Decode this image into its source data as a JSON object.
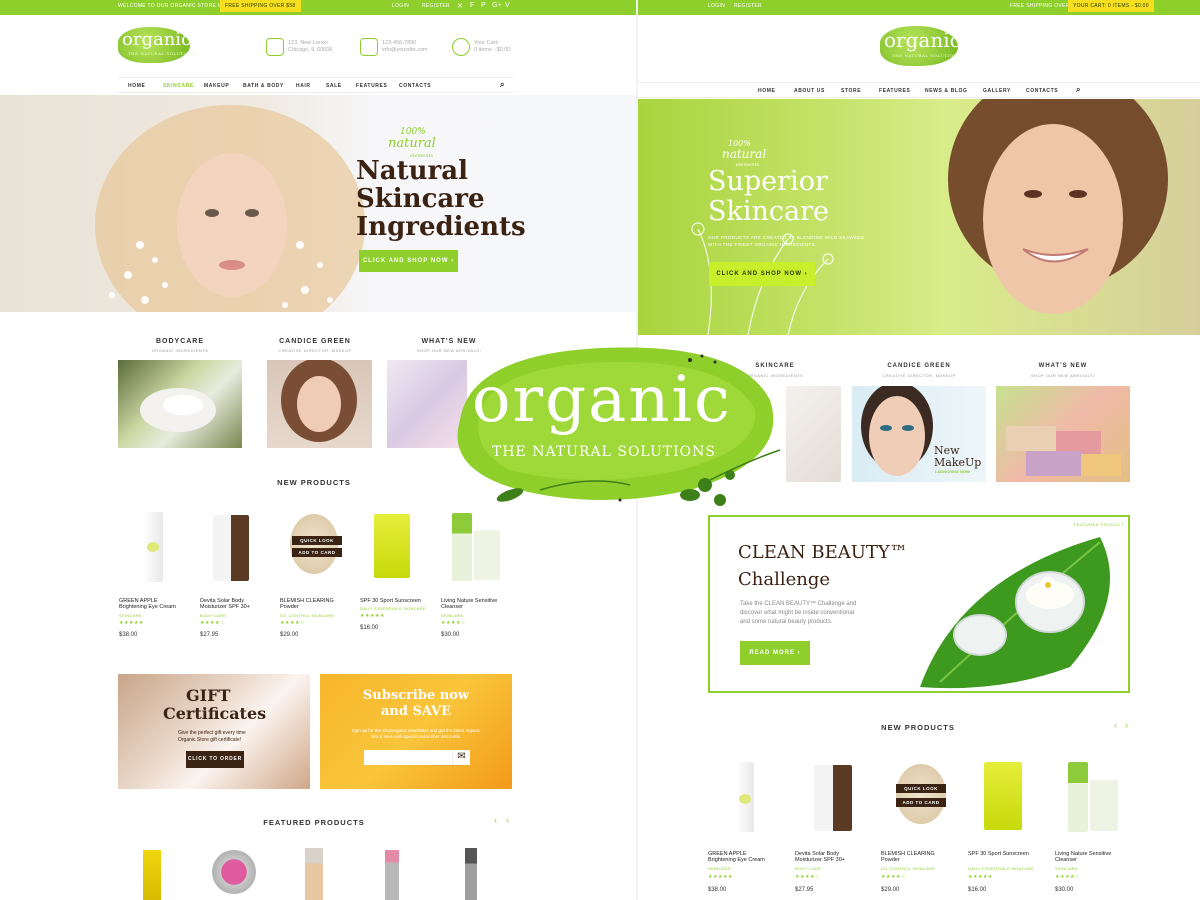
{
  "left": {
    "topbar": {
      "welcome": "WELCOME TO OUR ORGANIC STORE WEBSITE!",
      "shipping": "FREE SHIPPING OVER $58",
      "login": "LOGIN",
      "register": "REGISTER",
      "social_icons": [
        "twitter-icon",
        "facebook-icon",
        "pinterest-icon",
        "google-plus-icon",
        "vimeo-icon"
      ]
    },
    "logo": {
      "name": "organic",
      "tagline": "THE NATURAL SOLUTIONS"
    },
    "contacts": {
      "address_line1": "123, New Lenox",
      "address_line2": "Chicago, IL 60606",
      "phone": "123-456-7890",
      "email": "info@yoursite.com",
      "cart_label": "Your Cart:",
      "cart_value": "0 items - $0.00"
    },
    "nav": [
      "HOME",
      "SKINCARE",
      "MAKEUP",
      "BATH & BODY",
      "HAIR",
      "SALE",
      "FEATURES",
      "CONTACTS"
    ],
    "hero": {
      "badge_top": "100%",
      "badge_mid": "natural",
      "badge_bot": "elements",
      "line1": "Natural",
      "line2": "Skincare",
      "line3": "Ingredients",
      "cta": "CLICK AND SHOP NOW"
    },
    "cats": [
      {
        "title": "BODYCARE",
        "sub": "ORGANIC INGREDIENTS"
      },
      {
        "title": "CANDICE GREEN",
        "sub": "CREATIVE DIRECTOR, MAKEUP"
      },
      {
        "title": "WHAT'S NEW",
        "sub": "SHOP OUR NEW ARRIVALS!"
      }
    ],
    "new_products_title": "NEW PRODUCTS",
    "products": [
      {
        "name1": "GREEN APPLE",
        "name2": "Brightening Eye Cream",
        "cat": "SKINCARE",
        "stars": "★★★★★",
        "price": "$38.00"
      },
      {
        "name1": "Devita Solar Body",
        "name2": "Moisturizer SPF 30+",
        "cat": "BODY CARE",
        "stars": "★★★★☆",
        "price": "$27.95"
      },
      {
        "name1": "BLEMISH CLEARING",
        "name2": "Powder",
        "cat": "OIL CONTROL SKINCARE",
        "stars": "★★★★☆",
        "price": "$29.00"
      },
      {
        "name1": "SPF 30 Sport Sunscreen",
        "name2": "",
        "cat": "DAILY ESSENTIALS SKINCARE",
        "stars": "★★★★★",
        "price": "$16.00"
      },
      {
        "name1": "Living Nature Sensitive",
        "name2": "Cleanser",
        "cat": "SKINCARE",
        "stars": "★★★★☆",
        "price": "$30.00"
      }
    ],
    "quick_look": "QUICK LOOK",
    "add_to_card": "ADD TO CARD",
    "gift": {
      "line1": "GIFT",
      "line2": "Certificates",
      "text1": "Give the perfect gift every time",
      "text2": "Organic Store gift certificate!",
      "cta": "CLICK TO ORDER"
    },
    "subscribe": {
      "line1": "Subscribe now",
      "line2": "and SAVE",
      "text1": "Sign up for the shoporganic newsletter and get the latest organic",
      "text2": "info & save with special subscriber discounts."
    },
    "featured_title": "FEATURED PRODUCTS"
  },
  "center_logo": {
    "name": "organic",
    "tagline": "THE NATURAL SOLUTIONS"
  },
  "right": {
    "topbar": {
      "login": "LOGIN",
      "register": "REGISTER",
      "shipping": "FREE SHIPPING OVER $58",
      "cart": "YOUR CART: 0 ITEMS - $0.00"
    },
    "logo": {
      "name": "organic",
      "tagline": "THE NATURAL SOLUTIONS"
    },
    "nav": [
      "HOME",
      "ABOUT US",
      "STORE",
      "FEATURES",
      "NEWS & BLOG",
      "GALLERY",
      "CONTACTS"
    ],
    "hero": {
      "badge_top": "100%",
      "badge_mid": "natural",
      "badge_bot": "elements",
      "line1": "Superior",
      "line2": "Skincare",
      "text1": "OUR PRODUCTS ARE CREATED BY BLENDING WILD SEAWEED",
      "text2": "WITH THE FINEST ORGANIC INGREDIENTS",
      "cta": "CLICK AND SHOP NOW"
    },
    "cats": [
      {
        "title": "SKINCARE",
        "sub": "ORGANIC INGREDIENTS"
      },
      {
        "title": "CANDICE GREEN",
        "sub": "CREATIVE DIRECTOR, MAKEUP"
      },
      {
        "title": "WHAT'S NEW",
        "sub": "SHOP OUR NEW ARRIVALS!"
      }
    ],
    "makeup_line1": "New",
    "makeup_line2": "MakeUp",
    "makeup_sub": "LAUNCHING NOW",
    "banner": {
      "tag": "FEATURED PRODUCT",
      "line1": "CLEAN BEAUTY™",
      "line2": "Challenge",
      "text1": "Take the CLEAN BEAUTY™ Challenge and",
      "text2": "discover what might be inside conventional",
      "text3": "and some natural beauty products.",
      "cta": "READ MORE"
    },
    "new_products_title": "NEW PRODUCTS",
    "products": [
      {
        "name1": "GREEN APPLE",
        "name2": "Brightening Eye Cream",
        "cat": "SKINCARE",
        "stars": "★★★★★",
        "price": "$38.00"
      },
      {
        "name1": "Devita Solar Body",
        "name2": "Moisturizer SPF 30+",
        "cat": "BODY CARE",
        "stars": "★★★★☆",
        "price": "$27.95"
      },
      {
        "name1": "BLEMISH CLEARING",
        "name2": "Powder",
        "cat": "OIL CONTROL SKINCARE",
        "stars": "★★★★☆",
        "price": "$29.00"
      },
      {
        "name1": "SPF 30 Sport Sunscreen",
        "name2": "",
        "cat": "DAILY ESSENTIALS SKINCARE",
        "stars": "★★★★★",
        "price": "$16.00"
      },
      {
        "name1": "Living Nature Sensitive",
        "name2": "Cleanser",
        "cat": "SKINCARE",
        "stars": "★★★★☆",
        "price": "$30.00"
      }
    ],
    "quick_look": "QUICK LOOK",
    "add_to_card": "ADD TO CARD"
  },
  "colors": {
    "accent": "#8fcf2c",
    "dark": "#3b2314",
    "yellow": "#f6df1e",
    "orange": "#f7a51c"
  }
}
